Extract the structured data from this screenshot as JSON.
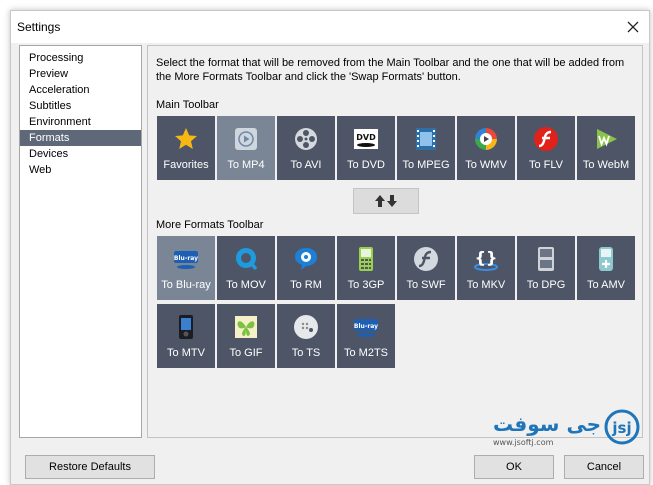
{
  "window": {
    "title": "Settings"
  },
  "sidebar": {
    "items": [
      {
        "label": "Processing"
      },
      {
        "label": "Preview"
      },
      {
        "label": "Acceleration"
      },
      {
        "label": "Subtitles"
      },
      {
        "label": "Environment"
      },
      {
        "label": "Formats",
        "selected": true
      },
      {
        "label": "Devices"
      },
      {
        "label": "Web"
      }
    ]
  },
  "formats": {
    "description": "Select the format that will be removed from the Main Toolbar and the one that will be added from the More Formats Toolbar and click the 'Swap Formats' button.",
    "main_toolbar_label": "Main Toolbar",
    "more_toolbar_label": "More Formats Toolbar",
    "main_tiles": [
      {
        "label": "Favorites",
        "icon": "star-icon"
      },
      {
        "label": "To MP4",
        "icon": "mp4-icon",
        "selected": true
      },
      {
        "label": "To AVI",
        "icon": "film-reel-icon"
      },
      {
        "label": "To DVD",
        "icon": "dvd-icon"
      },
      {
        "label": "To MPEG",
        "icon": "film-strip-icon"
      },
      {
        "label": "To WMV",
        "icon": "wmv-icon"
      },
      {
        "label": "To FLV",
        "icon": "flash-icon"
      },
      {
        "label": "To WebM",
        "icon": "webm-icon"
      }
    ],
    "more_tiles": [
      {
        "label": "To Blu-ray",
        "icon": "bluray-icon",
        "selected": true
      },
      {
        "label": "To MOV",
        "icon": "quicktime-icon"
      },
      {
        "label": "To RM",
        "icon": "realmedia-icon"
      },
      {
        "label": "To 3GP",
        "icon": "phone-icon"
      },
      {
        "label": "To SWF",
        "icon": "swf-icon"
      },
      {
        "label": "To MKV",
        "icon": "mkv-icon"
      },
      {
        "label": "To DPG",
        "icon": "nintendo-ds-icon"
      },
      {
        "label": "To AMV",
        "icon": "mp3-player-icon"
      },
      {
        "label": "To MTV",
        "icon": "mtv-player-icon"
      },
      {
        "label": "To GIF",
        "icon": "gif-icon"
      },
      {
        "label": "To TS",
        "icon": "ts-icon"
      },
      {
        "label": "To M2TS",
        "icon": "m2ts-icon"
      }
    ],
    "swap_icon": "swap-arrows-icon"
  },
  "buttons": {
    "restore": "Restore Defaults",
    "ok": "OK",
    "cancel": "Cancel"
  },
  "watermark": {
    "text": "جی سوفت",
    "url": "www.jsoftj.com",
    "logo": "jsj"
  },
  "colors": {
    "tile": "#4d5566",
    "tile_selected": "#7a8596",
    "nav_selected": "#5f6878"
  }
}
